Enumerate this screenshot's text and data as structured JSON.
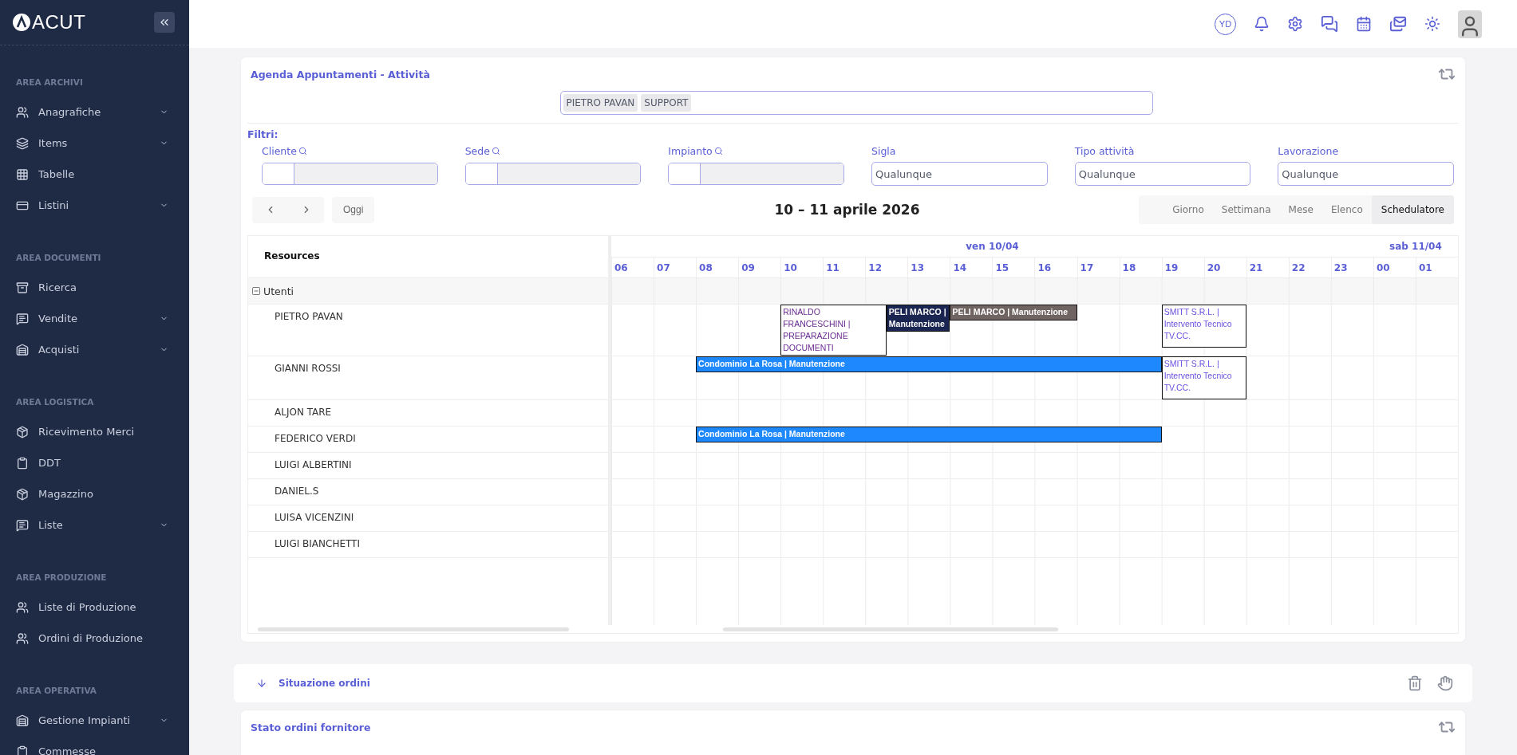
{
  "brand": {
    "name": "ACUT"
  },
  "sidebar": {
    "sections": [
      {
        "title": "AREA ARCHIVI",
        "items": [
          {
            "label": "Anagrafiche",
            "expandable": true
          },
          {
            "label": "Items",
            "expandable": true
          },
          {
            "label": "Tabelle",
            "expandable": false
          },
          {
            "label": "Listini",
            "expandable": true
          }
        ]
      },
      {
        "title": "AREA DOCUMENTI",
        "items": [
          {
            "label": "Ricerca",
            "expandable": false
          },
          {
            "label": "Vendite",
            "expandable": true
          },
          {
            "label": "Acquisti",
            "expandable": true
          }
        ]
      },
      {
        "title": "AREA LOGISTICA",
        "items": [
          {
            "label": "Ricevimento Merci",
            "expandable": false
          },
          {
            "label": "DDT",
            "expandable": false
          },
          {
            "label": "Magazzino",
            "expandable": false
          },
          {
            "label": "Liste",
            "expandable": true
          }
        ]
      },
      {
        "title": "AREA PRODUZIONE",
        "items": [
          {
            "label": "Liste di Produzione",
            "expandable": false
          },
          {
            "label": "Ordini di Produzione",
            "expandable": false
          }
        ]
      },
      {
        "title": "AREA OPERATIVA",
        "items": [
          {
            "label": "Gestione Impianti",
            "expandable": true
          },
          {
            "label": "Commesse",
            "expandable": false
          }
        ]
      }
    ]
  },
  "header": {
    "user_initials": "YD"
  },
  "agenda": {
    "title": "Agenda Appuntamenti - Attività",
    "resource_tags": [
      "PIETRO PAVAN",
      "SUPPORT"
    ],
    "filters_label": "Filtri:",
    "lookup_filters": [
      {
        "label": "Cliente"
      },
      {
        "label": "Sede"
      },
      {
        "label": "Impianto"
      }
    ],
    "select_filters": [
      {
        "label": "Sigla",
        "value": "Qualunque"
      },
      {
        "label": "Tipo attività",
        "value": "Qualunque"
      },
      {
        "label": "Lavorazione",
        "value": "Qualunque"
      }
    ],
    "today_button": "Oggi",
    "date_range": "10 – 11 aprile 2026",
    "views": [
      {
        "label": "Giorno",
        "selected": false
      },
      {
        "label": "Settimana",
        "selected": false
      },
      {
        "label": "Mese",
        "selected": false
      },
      {
        "label": "Elenco",
        "selected": false
      },
      {
        "label": "Schedulatore",
        "selected": true
      }
    ]
  },
  "scheduler": {
    "resource_header": "Resources",
    "days": [
      {
        "label": "ven 10/04",
        "hours": [
          "06",
          "07",
          "08",
          "09",
          "10",
          "11",
          "12",
          "13",
          "14",
          "15",
          "16",
          "17",
          "18",
          "19",
          "20",
          "21",
          "22",
          "23"
        ]
      },
      {
        "label": "sab 11/04",
        "hours": [
          "00",
          "01"
        ]
      }
    ],
    "group": {
      "label": "Utenti",
      "expanded": true
    },
    "resources": [
      {
        "name": "PIETRO PAVAN",
        "events": [
          {
            "label": "RINALDO FRANCESCHINI | PREPARAZIONE DOCUMENTI",
            "kind": "outline",
            "color": "#6a2c91"
          },
          {
            "label": "PELI MARCO | Manutenzione",
            "kind": "filled",
            "color": "#1b2552"
          },
          {
            "label": "PELI MARCO | Manutenzione",
            "kind": "filled",
            "color": "#6f6461"
          },
          {
            "label": "SMITT S.R.L. | Intervento Tecnico TV.CC.",
            "kind": "outline",
            "color": "#6c4fe0"
          }
        ]
      },
      {
        "name": "GIANNI ROSSI",
        "events": [
          {
            "label": "Condominio La Rosa | Manutenzione",
            "kind": "filled",
            "color": "#1e88ff"
          },
          {
            "label": "SMITT S.R.L. | Intervento Tecnico TV.CC.",
            "kind": "outline",
            "color": "#6c4fe0"
          }
        ]
      },
      {
        "name": "ALJON TARE"
      },
      {
        "name": "FEDERICO VERDI",
        "events": [
          {
            "label": "Condominio La Rosa | Manutenzione",
            "kind": "filled",
            "color": "#1e88ff"
          }
        ]
      },
      {
        "name": "LUIGI ALBERTINI"
      },
      {
        "name": "DANIEL.S"
      },
      {
        "name": "LUISA VICENZINI"
      },
      {
        "name": "LUIGI BIANCHETTI"
      }
    ]
  },
  "orders_panel": {
    "title": "Situazione ordini"
  },
  "supplier_card": {
    "title": "Stato ordini fornitore"
  }
}
